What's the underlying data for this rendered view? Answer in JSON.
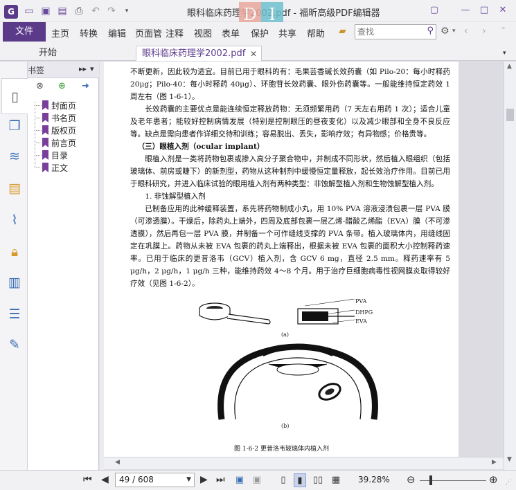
{
  "titlebar": {
    "title": "眼科临床药理学2002.pdf - 福昕高级PDF编辑器",
    "logo_left": "D",
    "logo_right": "I",
    "quick_icons": [
      "folder-open-icon",
      "save-icon",
      "save-as-icon",
      "print-icon",
      "undo-icon",
      "redo-icon",
      "customize-dropdown-icon"
    ],
    "window_icons": [
      "restore-icon",
      "minimize-icon",
      "maximize-icon",
      "close-icon"
    ]
  },
  "menu": {
    "file": "文件",
    "items": [
      "主页",
      "转换",
      "编辑",
      "页面管",
      "注释",
      "视图",
      "表单",
      "保护",
      "共享",
      "帮助"
    ],
    "search_placeholder": "查找"
  },
  "tabs": {
    "start": "开始",
    "doc": "眼科临床药理学2002.pdf"
  },
  "bookmarks": {
    "title": "书签",
    "items": [
      "封面页",
      "书名页",
      "版权页",
      "前言页",
      "目录",
      "正文"
    ]
  },
  "page": {
    "paragraphs": [
      "不断更新，因此较为适宜。目前已用于眼科的有：毛果芸香碱长效药囊（如 Pilo-20：每小时释药 20μg；Pilo-40：每小时释药 40μg）、环胞苷长效药囊、眼外伤药囊等。一般能维持恒定药效 1 周左右（图 1-6-1）。",
      "长效药囊的主要优点是能连续恒定释放药物：无须频繁用药（7 天左右用药 1 次）；适合儿童及老年患者；能较好控制病情发展（特别是控制眼压的昼夜变化）以及减少眼部和全身不良反应等。缺点是需向患者作详细交待和训练；容易脱出、丢失，影响疗效；有异物感；价格贵等。",
      "（三）眼植入剂（ocular implant）",
      "眼植入剂是一类将药物包裹或掺入高分子聚合物中，并制成不同形状，然后植入眼组织（包括玻璃体、前房或睫下）的新剂型，药物从这种制剂中缓慢恒定量释放，起长效治疗作用。目前已用于眼科研究，并进入临床试验的眼用植入剂有两种类型：非蚀解型植入剂和生物蚀解型植入剂。",
      "1. 非蚀解型植入剂",
      "已制备应用的此种缓释装置，系先将药物制成小丸，用 10% PVA 溶液浸渍包裹一层 PVA 膜（可渗透膜）。干燥后，除药丸上端外，四周及底部包裹一层乙烯-醋酸乙烯酯（EVA）膜（不可渗透膜），然后再包一层 PVA 膜，并制备一个可作缝线支撑的 PVA 条带。植入玻璃体内，用缝线固定在巩膜上。药物从未被 EVA 包裹的药丸上端释出，根据未被 EVA 包裹的面积大小控制释药速率。已用于临床的更昔洛韦（GCV）植入剂，含 GCV 6 mg，直径 2.5 mm。释药速率有 5 μg/h，2 μg/h，1 μg/h 三种，能维持药效 4～8 个月。用于治疗巨细胞病毒性视网膜炎取得较好疗效（见图 1-6-2）。"
    ],
    "fig_labels": {
      "pva": "PVA",
      "dhpg": "DHPG",
      "eva": "EVA",
      "a": "(a)",
      "b": "(b)"
    },
    "fig_caption": "图 1-6-2  更昔洛韦玻璃体内植入剂"
  },
  "status": {
    "page_indicator": "49 / 608",
    "zoom": "39.28%",
    "zoom_fraction": 0.17
  }
}
